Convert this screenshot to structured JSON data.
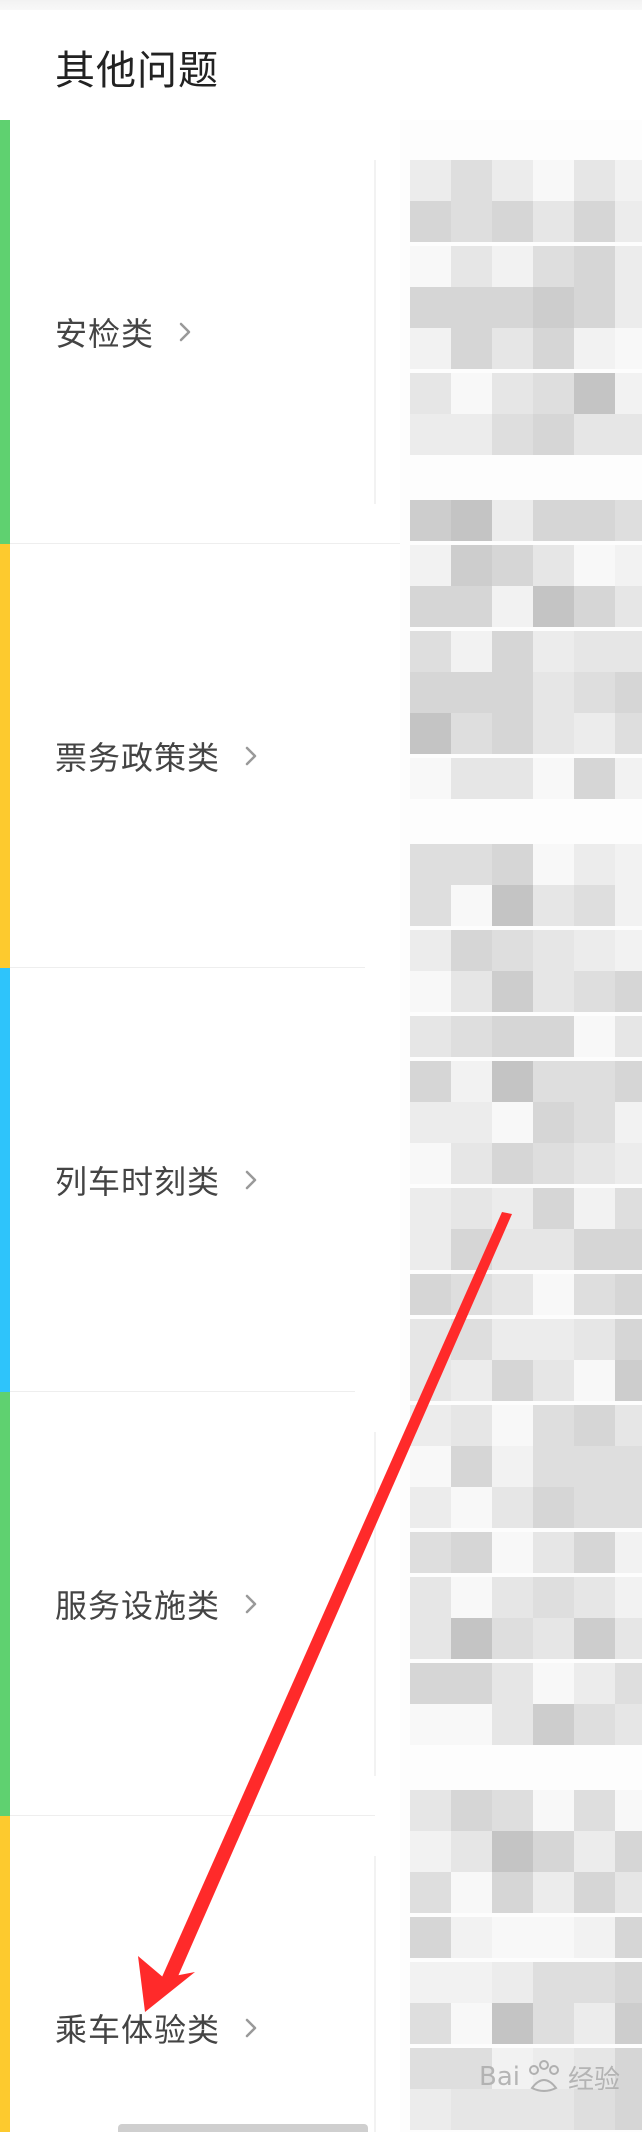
{
  "header": {
    "title": "其他问题"
  },
  "categories": [
    {
      "label": "安检类",
      "color": "#5fd170"
    },
    {
      "label": "票务政策类",
      "color": "#fdca2e"
    },
    {
      "label": "列车时刻类",
      "color": "#2ec4fb"
    },
    {
      "label": "服务设施类",
      "color": "#5fd170"
    },
    {
      "label": "乘车体验类",
      "color": "#fdca2e"
    }
  ],
  "annotation": {
    "arrow_color": "#ff2a2a"
  },
  "watermark": {
    "brand": "Bai",
    "suffix": "经验"
  }
}
